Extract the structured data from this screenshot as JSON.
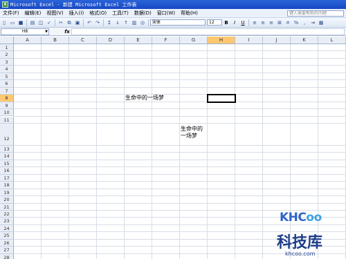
{
  "window": {
    "title": "Microsoft Excel - 新建 Microsoft Excel 工作表"
  },
  "menu": {
    "items": [
      "文件(F)",
      "编辑(E)",
      "视图(V)",
      "插入(I)",
      "格式(O)",
      "工具(T)",
      "数据(D)",
      "窗口(W)",
      "帮助(H)"
    ],
    "help_placeholder": "键入需要帮助的问题"
  },
  "toolbar": {
    "font_name": "宋体",
    "font_size": "12",
    "bold": "B",
    "italic": "I",
    "underline": "U"
  },
  "formula_bar": {
    "cell_ref": "H8",
    "fx": "fx",
    "value": ""
  },
  "grid": {
    "columns": [
      "A",
      "B",
      "C",
      "D",
      "E",
      "F",
      "G",
      "H",
      "I",
      "J",
      "K",
      "L"
    ],
    "rows": [
      "1",
      "2",
      "3",
      "4",
      "5",
      "6",
      "7",
      "8",
      "9",
      "10",
      "11",
      "12",
      "13",
      "14",
      "15",
      "16",
      "17",
      "18",
      "19",
      "20",
      "21",
      "22",
      "23",
      "24",
      "25",
      "26",
      "27",
      "28"
    ],
    "active_cell": "H8",
    "cells": {
      "E8": "生命中的一场梦",
      "G12_line1": "生命中的",
      "G12_line2": "一场梦"
    }
  },
  "watermark": {
    "logo": "KHC",
    "logo_tail": "oo",
    "name": "科技库",
    "url": "khcoo.com"
  }
}
